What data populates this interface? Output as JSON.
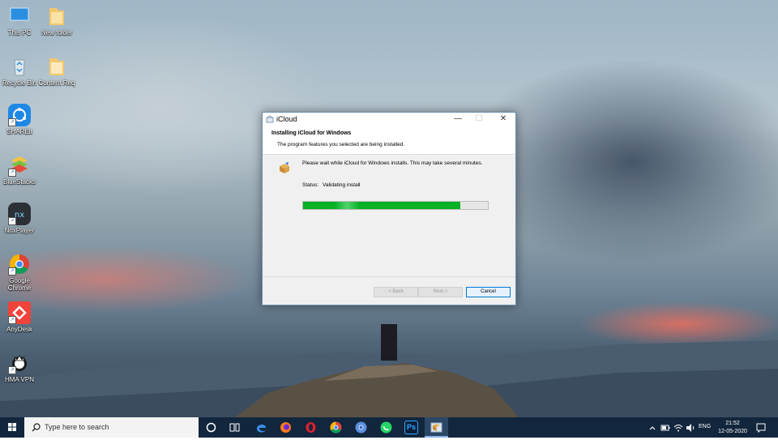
{
  "desktop": {
    "icons": [
      {
        "label": "This PC",
        "icon": "this-pc-icon"
      },
      {
        "label": "New folder",
        "icon": "folder-icon"
      },
      {
        "label": "Recycle Bin",
        "icon": "recycle-bin-icon"
      },
      {
        "label": "Content Req",
        "icon": "folder-icon"
      },
      {
        "label": "SHAREit",
        "icon": "shareit-icon"
      },
      {
        "label": "BlueStacks",
        "icon": "bluestacks-icon"
      },
      {
        "label": "NoxPlayer",
        "icon": "nox-icon"
      },
      {
        "label": "Google Chrome",
        "icon": "chrome-icon"
      },
      {
        "label": "AnyDesk",
        "icon": "anydesk-icon"
      },
      {
        "label": "HMA VPN",
        "icon": "hma-vpn-icon"
      }
    ]
  },
  "dialog": {
    "title": "iCloud",
    "minimize_glyph": "—",
    "maximize_glyph": "☐",
    "close_glyph": "✕",
    "header_title": "Installing iCloud for Windows",
    "header_subtitle": "The program features you selected are being installed.",
    "wait_text": "Please wait while iCloud for Windows installs. This may take several minutes.",
    "status_label": "Status:",
    "status_value": "Validating install",
    "progress_fraction": 0.85,
    "progress_color": "#06b025",
    "buttons": {
      "back": "< Back",
      "next": "Next >",
      "cancel": "Cancel"
    }
  },
  "taskbar": {
    "search_placeholder": "Type here to search",
    "apps": [
      "cortana-icon",
      "task-view-icon",
      "edge-icon",
      "firefox-icon",
      "opera-icon",
      "chrome-icon",
      "chromium-icon",
      "whatsapp-icon",
      "photoshop-icon",
      "installer-icon"
    ],
    "photoshop_label": "Ps",
    "language": "ENG",
    "time": "21:52",
    "date": "12-05-2020"
  }
}
